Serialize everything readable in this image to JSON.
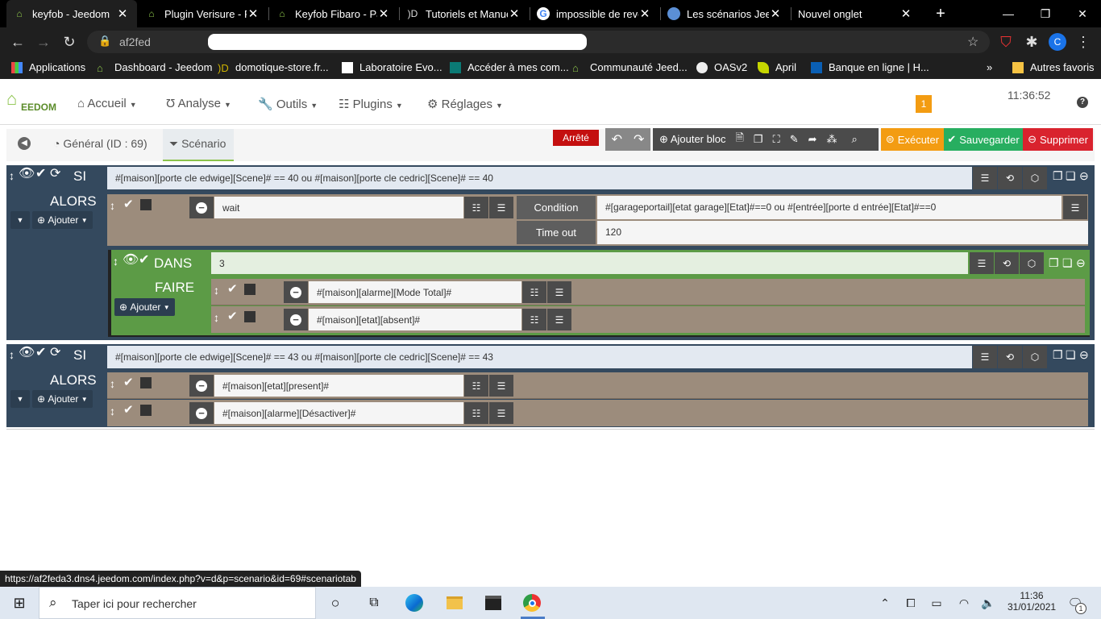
{
  "browser": {
    "tabs": [
      {
        "title": "keyfob - Jeedom",
        "active": true
      },
      {
        "title": "Plugin Verisure - P",
        "active": false
      },
      {
        "title": "Keyfob Fibaro - Pa",
        "active": false
      },
      {
        "title": "Tutoriels et Manue",
        "active": false
      },
      {
        "title": "impossible de reve",
        "active": false
      },
      {
        "title": "Les scénarios Jeed",
        "active": false
      },
      {
        "title": "Nouvel onglet",
        "active": false
      }
    ],
    "url_partial": "af2fed",
    "bookmarks": [
      "Applications",
      "Dashboard - Jeedom",
      "domotique-store.fr...",
      "Laboratoire Evo...",
      "Accéder à mes com...",
      "Communauté Jeed...",
      "OASv2",
      "April",
      "Banque en ligne | H..."
    ],
    "other_bookmarks": "Autres favoris",
    "status_url": "https://af2feda3.dns4.jeedom.com/index.php?v=d&p=scenario&id=69#scenariotab",
    "profile_initial": "C"
  },
  "navbar": {
    "logo_text": "EEDOM",
    "menus": [
      "Accueil",
      "Analyse",
      "Outils",
      "Plugins",
      "Réglages"
    ],
    "badge": "1",
    "clock": "11:36:52"
  },
  "tabs": {
    "general": "Général (ID : 69)",
    "scenario": "Scénario"
  },
  "toolbar": {
    "status": "Arrêté",
    "add_block": "Ajouter bloc",
    "execute": "Exécuter",
    "save": "Sauvegarder",
    "delete": "Supprimer"
  },
  "block1": {
    "si": "SI",
    "condition": "#[maison][porte cle edwige][Scene]# == 40 ou #[maison][porte cle cedric][Scene]# == 40",
    "alors": "ALORS",
    "ajouter": "Ajouter",
    "action_wait": "wait",
    "condition_label": "Condition",
    "condition_value": "#[garageportail][etat garage][Etat]#==0 ou #[entrée][porte d entrée][Etat]#==0",
    "timeout_label": "Time out",
    "timeout_value": "120",
    "dans": "DANS",
    "dans_value": "3",
    "faire": "FAIRE",
    "faire_ajouter": "Ajouter",
    "faire_actions": [
      "#[maison][alarme][Mode Total]#",
      "#[maison][etat][absent]#"
    ]
  },
  "block2": {
    "si": "SI",
    "condition": "#[maison][porte cle edwige][Scene]# == 43 ou #[maison][porte cle cedric][Scene]# == 43",
    "alors": "ALORS",
    "ajouter": "Ajouter",
    "actions": [
      "#[maison][etat][present]#",
      "#[maison][alarme][Désactiver]#"
    ]
  },
  "taskbar": {
    "search_placeholder": "Taper ici pour rechercher",
    "time": "11:36",
    "date": "31/01/2021",
    "notif_count": "1"
  },
  "colors": {
    "block_dark": "#34495e",
    "dans_green": "#5c9b46",
    "action_gray": "#9c8c7c",
    "execute_orange": "#f39c12",
    "save_green": "#27ae60",
    "delete_red": "#d9232e",
    "status_red": "#c40f0f"
  }
}
